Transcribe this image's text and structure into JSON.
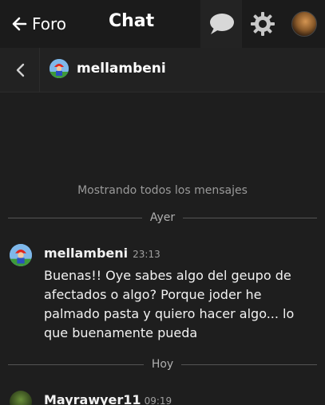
{
  "header": {
    "back_label": "Foro",
    "title": "Chat",
    "icons": [
      "chat-bubble-icon",
      "gear-icon",
      "user-avatar"
    ]
  },
  "channel": {
    "username": "mellambeni"
  },
  "conversation": {
    "notice": "Mostrando todos los mensajes",
    "divider_yesterday": "Ayer",
    "divider_today": "Hoy",
    "messages": [
      {
        "author": "mellambeni",
        "time": "23:13",
        "text": "Buenas!! Oye sabes algo del geupo de afectados o algo? Porque joder he palmado pasta y quiero hacer algo... lo que buenamente pueda"
      },
      {
        "author": "Mayrawyer11",
        "time": "09:19"
      }
    ]
  },
  "colors": {
    "background": "#1e1e1e",
    "topbar": "#1b1b1b",
    "subbar": "#222222",
    "text": "#f2f2f2",
    "muted": "#9a9a9a"
  }
}
